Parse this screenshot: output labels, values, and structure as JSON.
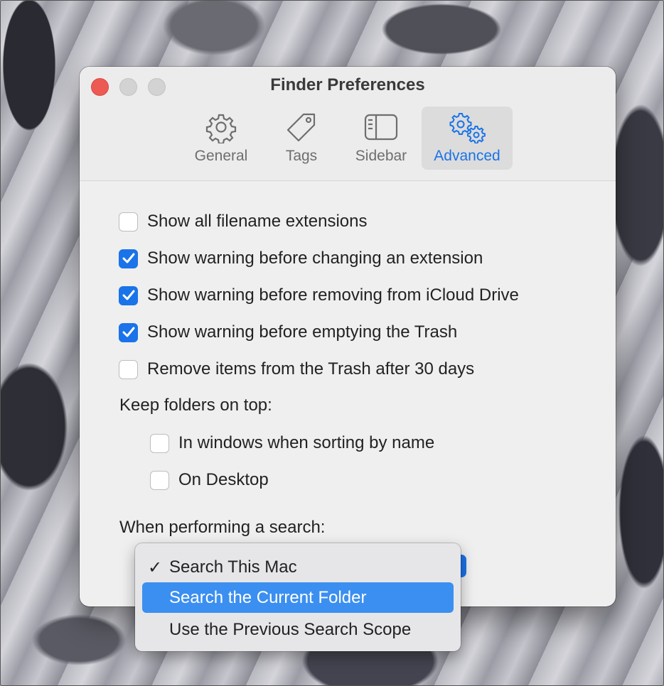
{
  "window": {
    "title": "Finder Preferences"
  },
  "tabs": [
    {
      "label": "General",
      "icon": "gear-icon",
      "active": false
    },
    {
      "label": "Tags",
      "icon": "tag-icon",
      "active": false
    },
    {
      "label": "Sidebar",
      "icon": "sidebar-icon",
      "active": false
    },
    {
      "label": "Advanced",
      "icon": "gears-icon",
      "active": true
    }
  ],
  "options": [
    {
      "label": "Show all filename extensions",
      "checked": false
    },
    {
      "label": "Show warning before changing an extension",
      "checked": true
    },
    {
      "label": "Show warning before removing from iCloud Drive",
      "checked": true
    },
    {
      "label": "Show warning before emptying the Trash",
      "checked": true
    },
    {
      "label": "Remove items from the Trash after 30 days",
      "checked": false
    }
  ],
  "keep_folders": {
    "heading": "Keep folders on top:",
    "options": [
      {
        "label": "In windows when sorting by name",
        "checked": false
      },
      {
        "label": "On Desktop",
        "checked": false
      }
    ]
  },
  "search": {
    "heading": "When performing a search:",
    "menu": [
      {
        "label": "Search This Mac",
        "checkmark": "✓",
        "selected": true,
        "highlighted": false
      },
      {
        "label": "Search the Current Folder",
        "selected": false,
        "highlighted": true
      },
      {
        "label": "Use the Previous Search Scope",
        "selected": false,
        "highlighted": false
      }
    ]
  },
  "colors": {
    "accent": "#1a73e8",
    "highlight": "#3b8ff0",
    "close": "#ed5a54"
  }
}
